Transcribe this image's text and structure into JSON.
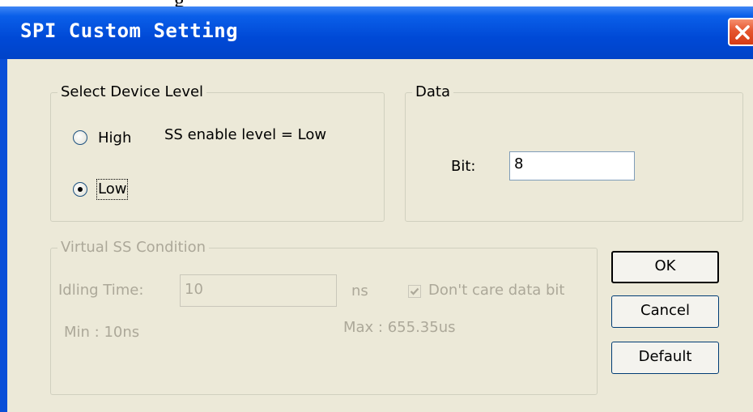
{
  "window": {
    "title": "SPI Custom Setting"
  },
  "device_level": {
    "legend": "Select Device Level",
    "options": [
      {
        "label": "High",
        "checked": false
      },
      {
        "label": "Low",
        "checked": true
      }
    ],
    "ss_enable_text": "SS enable level  = Low"
  },
  "data": {
    "legend": "Data",
    "bit_label": "Bit:",
    "bit_value": "8"
  },
  "virtual_ss": {
    "legend": "Virtual  SS Condition",
    "idling_label": "Idling Time:",
    "idling_value": "10",
    "unit": "ns",
    "dont_care_label": "Don't care data bit",
    "dont_care_checked": true,
    "min_text": "Min : 10ns",
    "max_text": "Max : 655.35us"
  },
  "buttons": {
    "ok": "OK",
    "cancel": "Cancel",
    "default": "Default"
  }
}
